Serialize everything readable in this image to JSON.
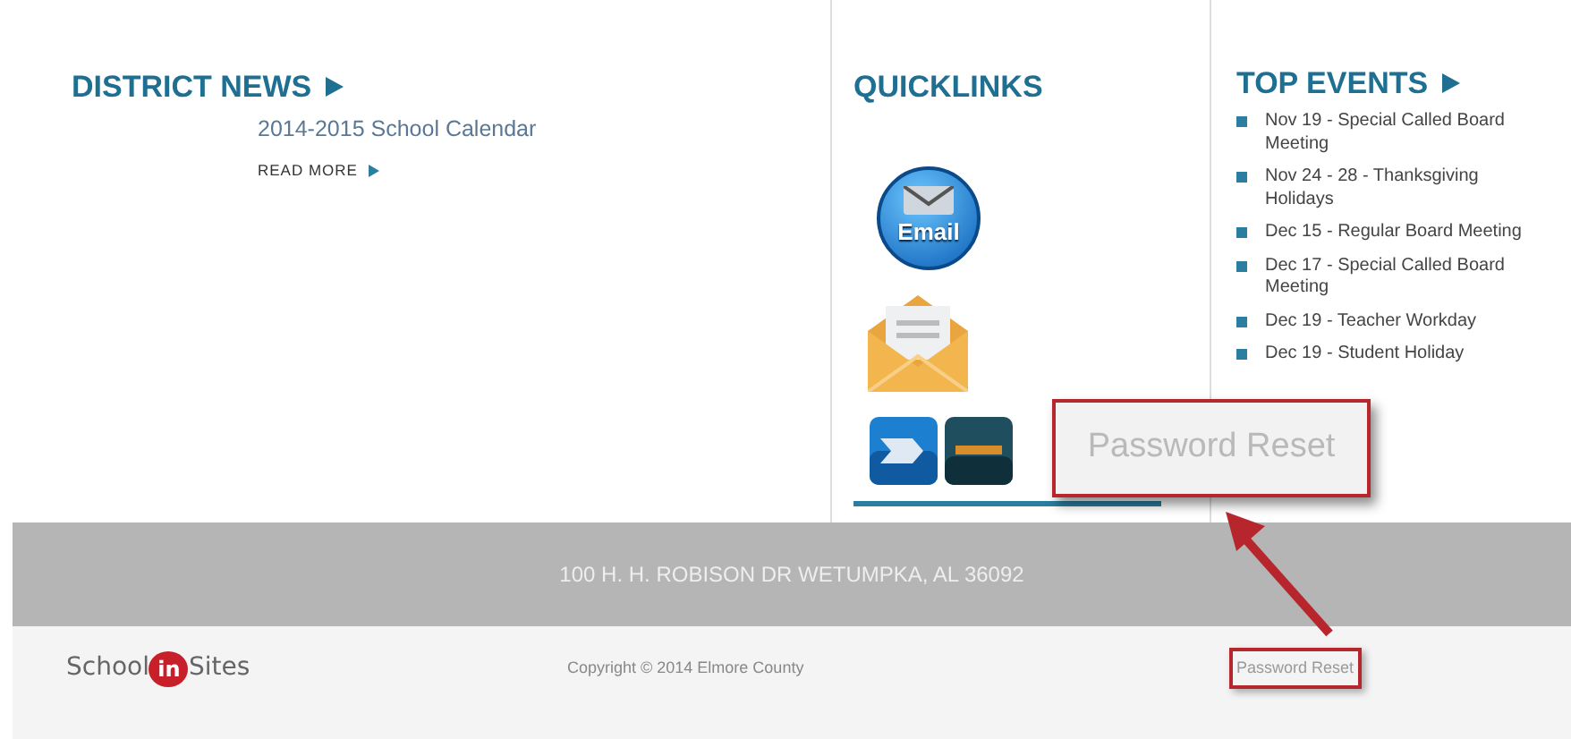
{
  "district_news": {
    "heading": "DISTRICT NEWS",
    "items": [
      {
        "title": "2014-2015 School Calendar",
        "link": "READ MORE"
      }
    ]
  },
  "quicklinks": {
    "heading": "QUICKLINKS",
    "email_label": "Email"
  },
  "top_events": {
    "heading": "TOP EVENTS",
    "items": [
      "Nov 19 - Special Called Board Meeting",
      "Nov 24 - 28 - Thanksgiving Holidays",
      "Dec 15 - Regular Board Meeting",
      "Dec 17 - Special Called Board Meeting",
      "Dec 19 - Teacher Workday",
      "Dec 19 - Student Holiday"
    ]
  },
  "callout": {
    "text": "Password Reset"
  },
  "address_bar": {
    "text": "100 H. H. ROBISON DR WETUMPKA, AL 36092"
  },
  "footer": {
    "logo": [
      "School",
      "in",
      "Sites"
    ],
    "copyright": "Copyright © 2014 Elmore County",
    "link": "Password Reset"
  }
}
